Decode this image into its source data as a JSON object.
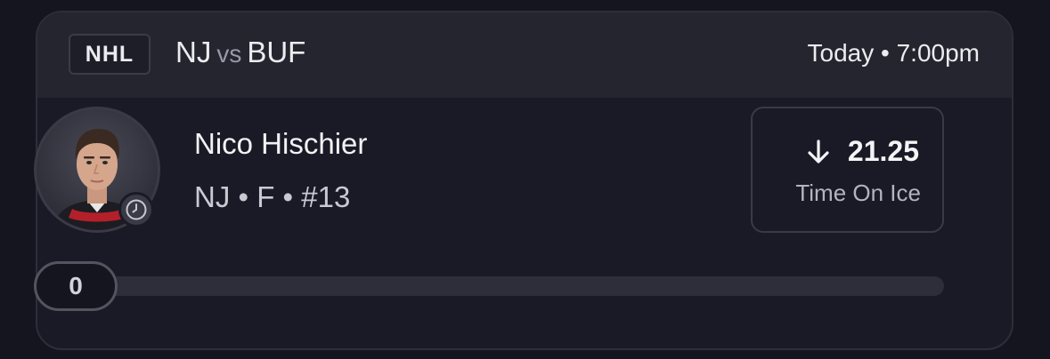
{
  "header": {
    "league": "NHL",
    "home_team": "NJ",
    "vs": "vs",
    "away_team": "BUF",
    "time": "Today • 7:00pm"
  },
  "player": {
    "name": "Nico Hischier",
    "meta": "NJ • F • #13",
    "avatar_icon": "player-headshot",
    "status_icon": "clock-icon"
  },
  "stat": {
    "direction_icon": "arrow-down-icon",
    "value": "21.25",
    "label": "Time On Ice"
  },
  "progress": {
    "value": "0",
    "fraction": 0
  },
  "colors": {
    "background": "#15151f",
    "card": "#1a1a26",
    "header": "#25252f",
    "text": "#ececf0",
    "muted": "#9898a6"
  }
}
